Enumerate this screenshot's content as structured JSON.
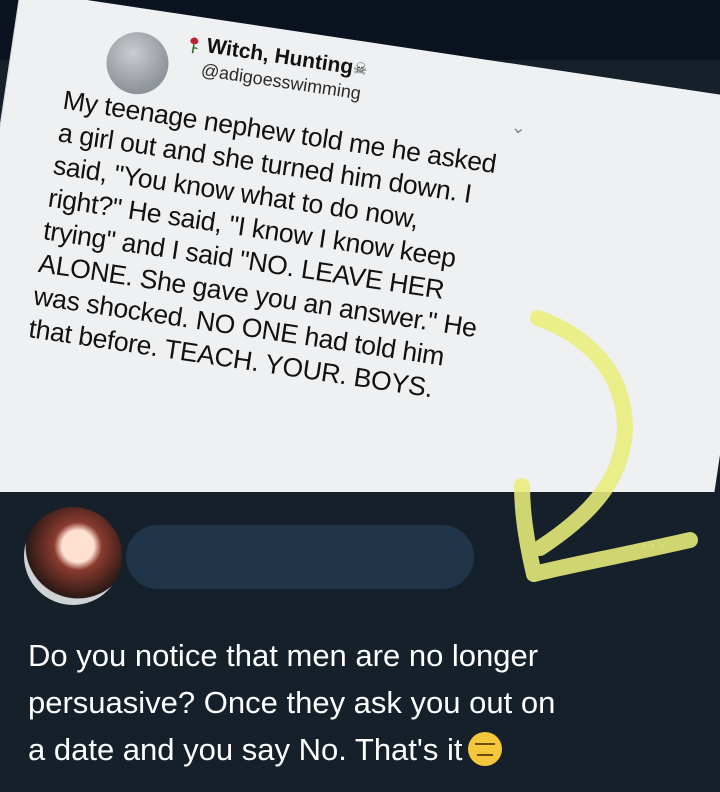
{
  "tweet_light": {
    "name": "Witch, Hunting",
    "handle": "@adigoesswimming",
    "name_icon": "rose-icon",
    "handle_icon": "skull-icon",
    "text_lines": [
      "My teenage nephew told me he asked",
      "a girl out and she turned him down. I",
      "said, \"You know what to do now,",
      "right?\" He said, \"I know I know keep",
      "trying\" and I said \"NO. LEAVE HER",
      "ALONE. She gave you an answer.\" He",
      "was shocked. NO ONE had told him",
      "that before. TEACH. YOUR. BOYS."
    ]
  },
  "tweet_dark": {
    "text_lines": [
      "Do you notice that men are no longer",
      "persuasive? Once they ask you out on",
      "a date and you say No. That's it"
    ],
    "emoji_icon": "expressionless-face-icon",
    "more_icon": "more-options-icon"
  },
  "annotation": {
    "type": "hand-drawn arrow",
    "color": "#e9ee7a"
  },
  "colors": {
    "light_bg": "#eef0f2",
    "dark_bg": "#15202b",
    "text_dark": "#111111",
    "text_light": "#ffffff"
  }
}
